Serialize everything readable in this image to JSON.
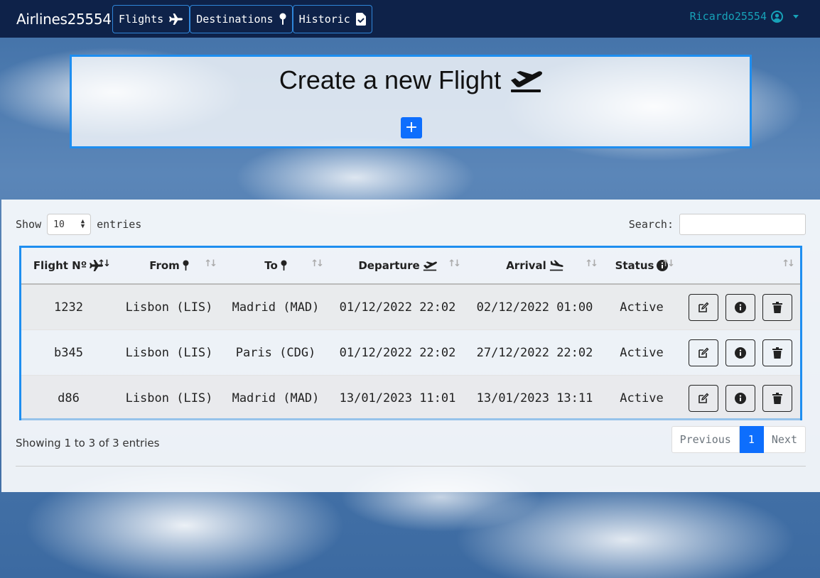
{
  "navbar": {
    "brand": "Airlines25554",
    "links": [
      {
        "label": "Flights",
        "icon": "plane-icon"
      },
      {
        "label": "Destinations",
        "icon": "map-pin-icon"
      },
      {
        "label": "Historic",
        "icon": "file-icon"
      }
    ],
    "user": "Ricardo25554"
  },
  "create": {
    "title": "Create a new Flight",
    "add_label": "+"
  },
  "table": {
    "show_label": "Show",
    "entries_label": "entries",
    "length_value": "10",
    "search_label": "Search:",
    "columns": [
      "Flight Nº",
      "From",
      "To",
      "Departure",
      "Arrival",
      "Status",
      ""
    ],
    "rows": [
      {
        "flight": "1232",
        "from": "Lisbon (LIS)",
        "to": "Madrid (MAD)",
        "departure": "01/12/2022 22:02",
        "arrival": "02/12/2022 01:00",
        "status": "Active"
      },
      {
        "flight": "b345",
        "from": "Lisbon (LIS)",
        "to": "Paris (CDG)",
        "departure": "01/12/2022 22:02",
        "arrival": "27/12/2022 22:02",
        "status": "Active"
      },
      {
        "flight": "d86",
        "from": "Lisbon (LIS)",
        "to": "Madrid (MAD)",
        "departure": "13/01/2023 11:01",
        "arrival": "13/01/2023 13:11",
        "status": "Active"
      }
    ],
    "info": "Showing 1 to 3 of 3 entries",
    "pagination": {
      "previous": "Previous",
      "current": "1",
      "next": "Next"
    }
  },
  "colors": {
    "navbar": "#0e2249",
    "accent": "#1e8ef0",
    "primary": "#0d6efd",
    "user": "#17a2b8"
  }
}
